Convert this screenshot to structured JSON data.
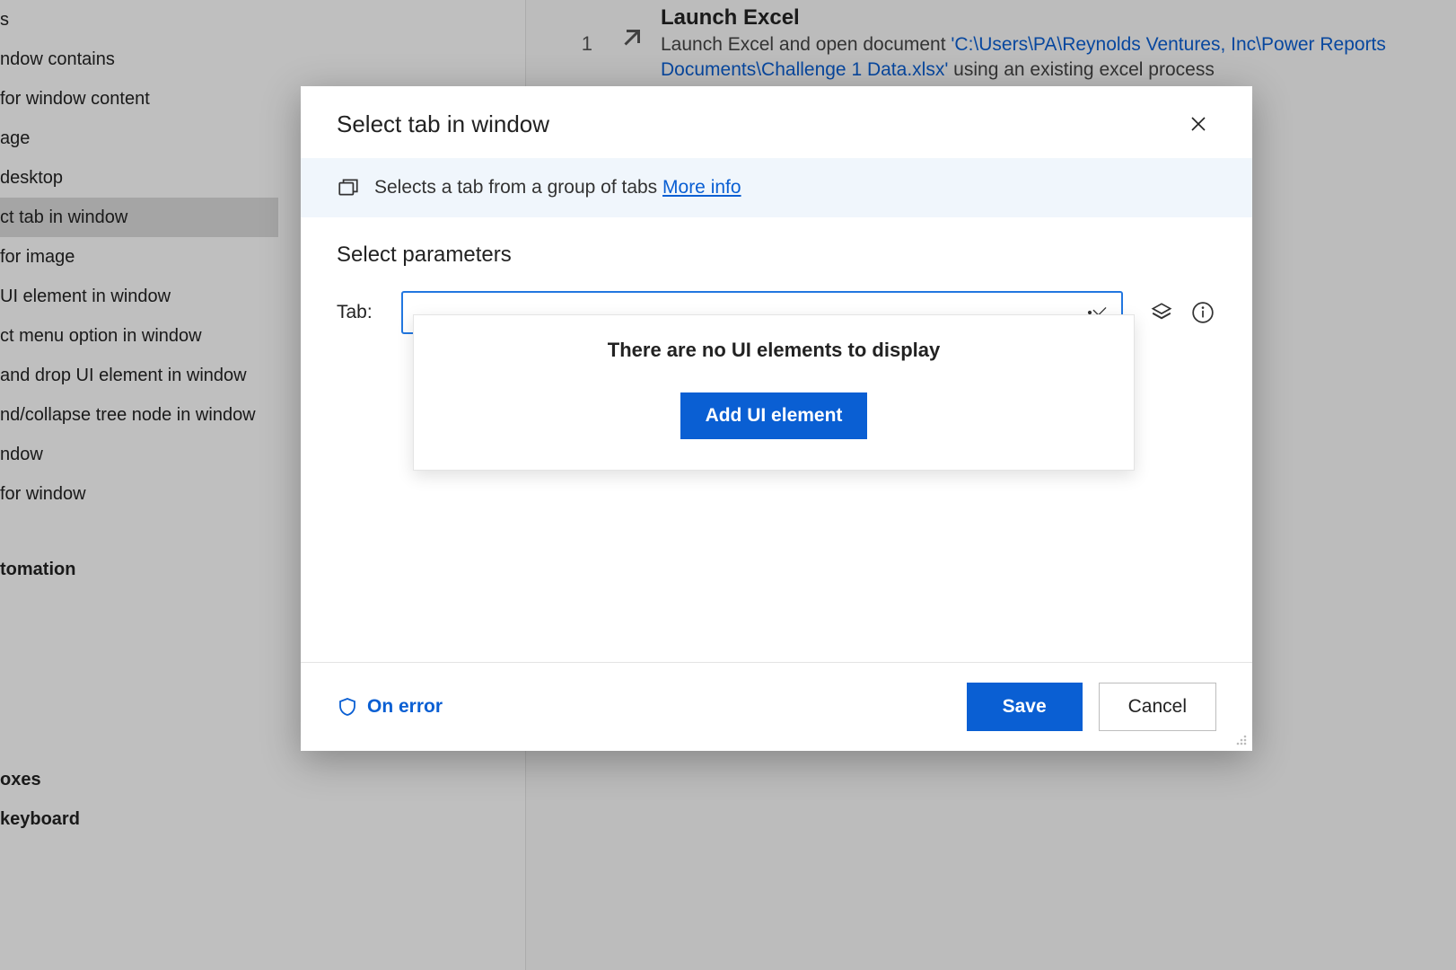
{
  "sidebar": {
    "items": [
      {
        "label": "s"
      },
      {
        "label": "ndow contains"
      },
      {
        "label": "for window content"
      },
      {
        "label": "age"
      },
      {
        "label": "desktop"
      },
      {
        "label": "ct tab in window",
        "selected": true
      },
      {
        "label": "for image"
      },
      {
        "label": "UI element in window"
      },
      {
        "label": "ct menu option in window"
      },
      {
        "label": "and drop UI element in window"
      },
      {
        "label": "nd/collapse tree node in window"
      },
      {
        "label": "ndow"
      },
      {
        "label": "for window"
      }
    ],
    "categories": [
      {
        "label": "tomation"
      },
      {
        "label": "oxes"
      },
      {
        "label": "keyboard"
      }
    ]
  },
  "flow": {
    "step_num": "1",
    "title": "Launch Excel",
    "desc_prefix": "Launch Excel and open document ",
    "desc_path": "'C:\\Users\\PA\\Reynolds Ventures, Inc\\Power Reports Documents\\Challenge 1 Data.xlsx'",
    "desc_suffix": " using an existing excel process"
  },
  "dialog": {
    "title": "Select tab in window",
    "info_text": "Selects a tab from a group of tabs ",
    "more_info": "More info",
    "section": "Select parameters",
    "param_label": "Tab:",
    "dropdown_empty": "There are no UI elements to display",
    "add_ui_element": "Add UI element",
    "on_error": "On error",
    "save": "Save",
    "cancel": "Cancel"
  }
}
